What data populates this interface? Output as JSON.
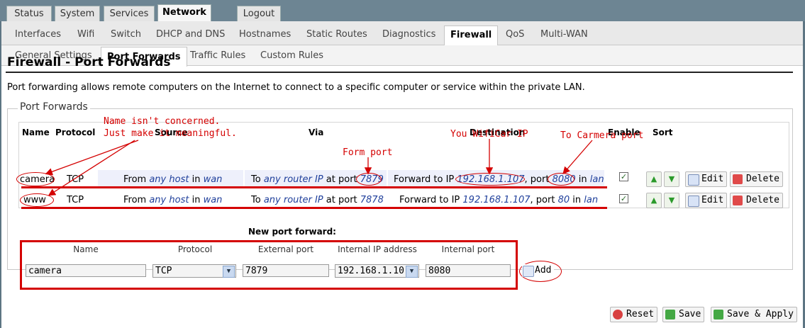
{
  "top_tabs": [
    "Status",
    "System",
    "Services",
    "Network",
    "Logout"
  ],
  "sub_tabs": [
    "Interfaces",
    "Wifi",
    "Switch",
    "DHCP and DNS",
    "Hostnames",
    "Static Routes",
    "Diagnostics",
    "Firewall",
    "QoS",
    "Multi-WAN"
  ],
  "section_tabs": [
    "General Settings",
    "Port Forwards",
    "Traffic Rules",
    "Custom Rules"
  ],
  "page": {
    "title": "Firewall - Port Forwards",
    "description": "Port forwarding allows remote computers on the Internet to connect to a specific computer or service within the private LAN.",
    "legend": "Port Forwards"
  },
  "table": {
    "headers": {
      "name": "Name",
      "protocol": "Protocol",
      "source": "Source",
      "via": "Via",
      "destination": "Destination",
      "enable": "Enable",
      "sort": "Sort"
    },
    "rows": [
      {
        "name": "camera",
        "protocol": "TCP",
        "src_pre": "From ",
        "src_host": "any host",
        "src_in": " in ",
        "src_zone": "wan",
        "via_pre": "To ",
        "via_ip": "any router IP",
        "via_port_pre": " at port ",
        "via_port": "7879",
        "dst_pre": "Forward to IP ",
        "dst_ip": "192.168.1.107",
        "dst_port_pre": ", port ",
        "dst_port": "8080",
        "dst_in": " in ",
        "dst_zone": "lan",
        "enabled": true
      },
      {
        "name": "www",
        "protocol": "TCP",
        "src_pre": "From ",
        "src_host": "any host",
        "src_in": " in ",
        "src_zone": "wan",
        "via_pre": "To ",
        "via_ip": "any router IP",
        "via_port_pre": " at port ",
        "via_port": "7878",
        "dst_pre": "Forward to IP ",
        "dst_ip": "192.168.1.107",
        "dst_port_pre": ", port ",
        "dst_port": "80",
        "dst_in": " in ",
        "dst_zone": "lan",
        "enabled": true
      }
    ],
    "edit_label": "Edit",
    "delete_label": "Delete"
  },
  "new_forward": {
    "title": "New port forward:",
    "labels": {
      "name": "Name",
      "protocol": "Protocol",
      "external_port": "External port",
      "internal_ip": "Internal IP address",
      "internal_port": "Internal port"
    },
    "values": {
      "name": "camera",
      "protocol": "TCP",
      "external_port": "7879",
      "internal_ip": "192.168.1.10",
      "internal_port": "8080"
    },
    "add_label": "Add"
  },
  "annotations": {
    "name_line1": "Name isn't concerned.",
    "name_line2": "Just make it meaningful.",
    "form_port": "Form port",
    "wificar_ip": "You WifiCar IP",
    "camera_port": "To Carmera port"
  },
  "footer": {
    "reset": "Reset",
    "save": "Save",
    "save_apply": "Save & Apply"
  },
  "colors": {
    "accent": "#d40000",
    "link": "#1f3f9b",
    "frame": "#6d8593"
  }
}
